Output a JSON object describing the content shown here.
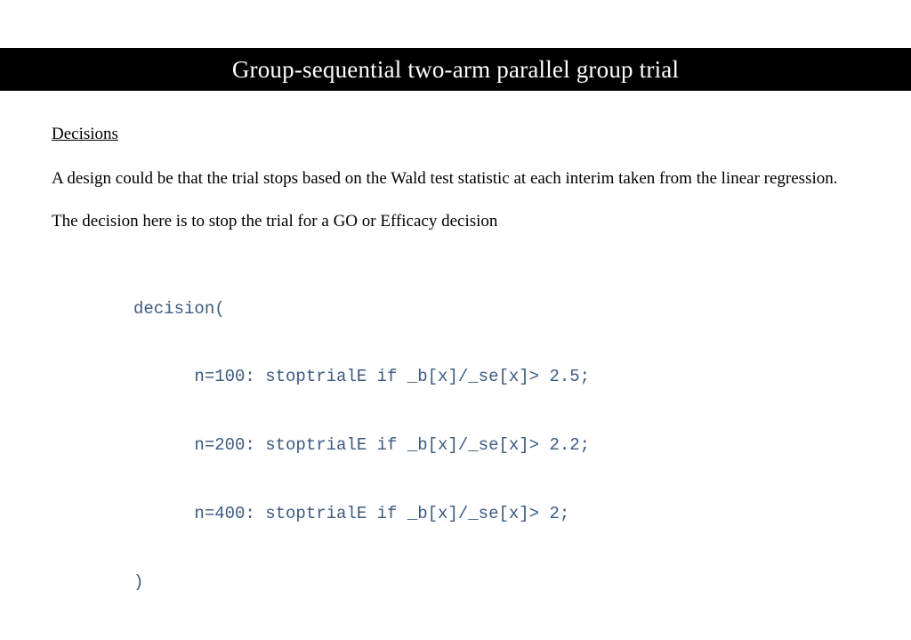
{
  "slide": {
    "title": "Group-sequential two-arm parallel group trial",
    "heading": "Decisions",
    "paragraph1": "A design could be that the trial stops based on the Wald test statistic at each interim taken from the linear regression.",
    "paragraph2": "The decision here is to stop the trial for a GO or Efficacy decision",
    "code": {
      "l1": "decision(",
      "l2": "      n=100: stoptrialE if _b[x]/_se[x]> 2.5;",
      "l3": "      n=200: stoptrialE if _b[x]/_se[x]> 2.2;",
      "l4": "      n=400: stoptrialE if _b[x]/_se[x]> 2;",
      "l5": ")"
    }
  }
}
